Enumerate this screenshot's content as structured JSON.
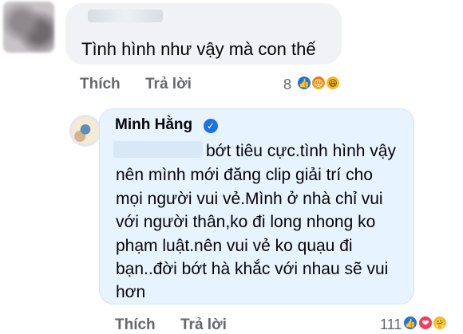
{
  "comment": {
    "text": "Tình hình như vậy mà con thế",
    "like_label": "Thích",
    "reply_label": "Trả lời",
    "reaction_count": "8",
    "reactions": [
      "like-icon",
      "angry-icon",
      "haha-icon"
    ]
  },
  "reply": {
    "author": "Minh Hằng",
    "lines": [
      "bớt tiêu cực.tình hình vậy",
      "nên mình mới đăng clip giải trí cho",
      "mọi người vui vẻ.Mình ở nhà chỉ vui",
      "với người thân,ko đi long nhong ko",
      "phạm luật.nên vui vẻ ko quạu đi",
      "bạn..đời bớt hà khắc với nhau sẽ vui",
      "hơn"
    ],
    "like_label": "Thích",
    "reply_label": "Trả lời",
    "reaction_count": "111",
    "reactions": [
      "like-icon",
      "love-icon",
      "care-icon"
    ]
  },
  "colors": {
    "link_blue": "#1b74e4",
    "bubble_grey": "#f0f2f5",
    "bubble_blue": "#e7f3ff"
  }
}
